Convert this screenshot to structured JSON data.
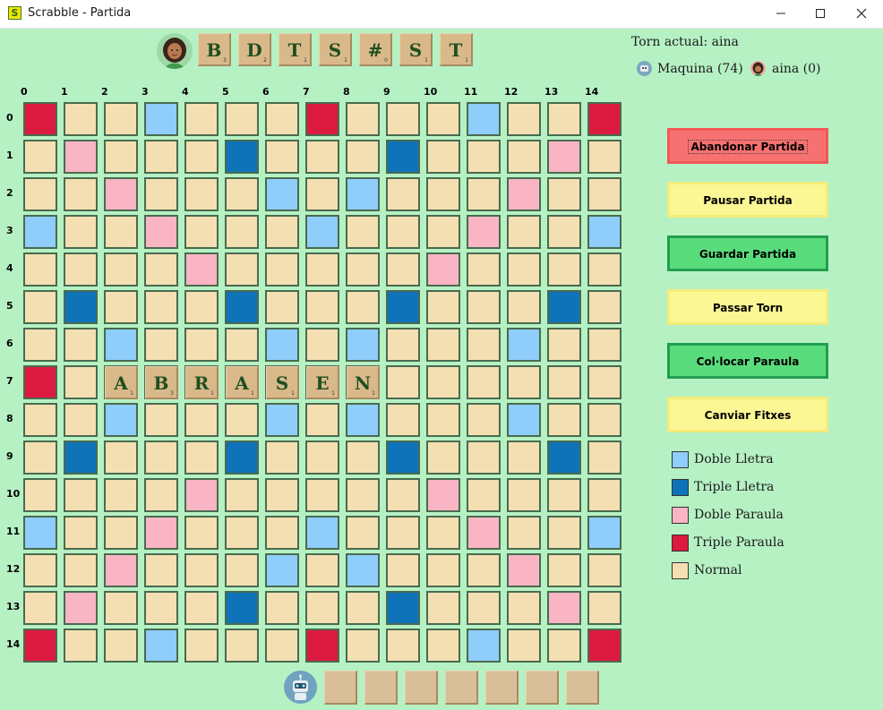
{
  "window": {
    "title": "Scrabble - Partida",
    "icon_letter": "S"
  },
  "colors": {
    "normal": "#f4dfb2",
    "dl": "#8fcdfa",
    "tl": "#0f73b9",
    "dw": "#f9b5c4",
    "tw": "#dc1a3f",
    "background": "#b6f1c4"
  },
  "player_rack": [
    {
      "letter": "B",
      "points": "3"
    },
    {
      "letter": "D",
      "points": "2"
    },
    {
      "letter": "T",
      "points": "1"
    },
    {
      "letter": "S",
      "points": "1"
    },
    {
      "letter": "#",
      "points": "0"
    },
    {
      "letter": "S",
      "points": "1"
    },
    {
      "letter": "T",
      "points": "1"
    }
  ],
  "turn_label": "Torn actual: aina",
  "scores": {
    "bot": "Maquina (74)",
    "player": "aina (0)"
  },
  "board": {
    "col_labels": [
      "0",
      "1",
      "2",
      "3",
      "4",
      "5",
      "6",
      "7",
      "8",
      "9",
      "10",
      "11",
      "12",
      "13",
      "14"
    ],
    "row_labels": [
      "0",
      "1",
      "2",
      "3",
      "4",
      "5",
      "6",
      "7",
      "8",
      "9",
      "10",
      "11",
      "12",
      "13",
      "14"
    ],
    "layout": [
      "T..d...T...d..T",
      ".D...t...t...D.",
      "..D...d.d...D..",
      "d..D...d...D..d",
      "....D.....D....",
      ".t...t...t...t.",
      "..d...d.d...d..",
      "T..............",
      "..d...d.d...d..",
      ".t...t...t...t.",
      "....D.....D....",
      "d..D...d...D..d",
      "..D...d.d...D..",
      ".D...t...t...D.",
      "T..d...T...d..T"
    ],
    "placed_tiles": [
      {
        "row": 7,
        "col": 2,
        "letter": "A",
        "points": "1"
      },
      {
        "row": 7,
        "col": 3,
        "letter": "B",
        "points": "3"
      },
      {
        "row": 7,
        "col": 4,
        "letter": "R",
        "points": "1"
      },
      {
        "row": 7,
        "col": 5,
        "letter": "A",
        "points": "1"
      },
      {
        "row": 7,
        "col": 6,
        "letter": "S",
        "points": "1"
      },
      {
        "row": 7,
        "col": 7,
        "letter": "E",
        "points": "1"
      },
      {
        "row": 7,
        "col": 8,
        "letter": "N",
        "points": "1"
      }
    ]
  },
  "buttons": {
    "abandon": "Abandonar Partida",
    "pause": "Pausar Partida",
    "save": "Guardar Partida",
    "pass": "Passar Torn",
    "place": "Col·locar Paraula",
    "swap": "Canviar Fitxes"
  },
  "legend": [
    {
      "key": "dl",
      "label": "Doble Lletra"
    },
    {
      "key": "tl",
      "label": "Triple Lletra"
    },
    {
      "key": "dw",
      "label": "Doble Paraula"
    },
    {
      "key": "tw",
      "label": "Triple Paraula"
    },
    {
      "key": "normal",
      "label": "Normal"
    }
  ],
  "bot_rack_count": 7
}
